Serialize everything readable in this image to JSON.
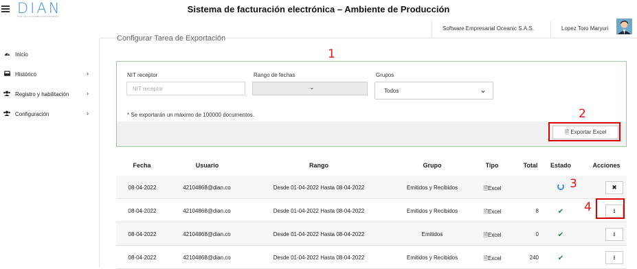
{
  "header": {
    "title": "Sistema de facturación electrónica – Ambiente de Producción",
    "logo_text": "DIAN",
    "logo_tagline": "POR UNA COLOMBIA MÁS HONESTA",
    "company": "Software Empresarial Oceanic S.A.S.",
    "user": "Lopez Toro Maryuri"
  },
  "sidebar": {
    "items": [
      {
        "label": "Inicio",
        "icon": "dashboard-icon"
      },
      {
        "label": "Histórico",
        "icon": "inbox-icon"
      },
      {
        "label": "Registro y habilitación",
        "icon": "users-icon"
      },
      {
        "label": "Configuración",
        "icon": "users-icon"
      }
    ]
  },
  "main": {
    "section_title": "Configurar Tarea de Exportación",
    "filters": {
      "nit_label": "NIT receptor",
      "nit_placeholder": "NIT receptor",
      "rango_label": "Rango de fechas",
      "grupos_label": "Grupos",
      "grupos_value": "Todos",
      "note": "* Se exportarán un máximo de 100000 documentos.",
      "export_button": "Exportar Excel"
    },
    "annotations": [
      "1",
      "2",
      "3",
      "4"
    ],
    "table": {
      "headers": [
        "Fecha",
        "Usuario",
        "Rango",
        "Grupo",
        "Tipo",
        "Total",
        "Estado",
        "Acciones"
      ],
      "rows": [
        {
          "fecha": "08-04-2022",
          "usuario": "42104868@dian.co",
          "rango": "Desde 01-04-2022 Hasta 08-04-2022",
          "grupo": "Emitidos y Recibidos",
          "tipo": "Excel",
          "total": "",
          "estado": "processing",
          "accion": "cancel"
        },
        {
          "fecha": "08-04-2022",
          "usuario": "42104868@dian.co",
          "rango": "Desde 01-04-2022 Hasta 08-04-2022",
          "grupo": "Emitidos y Recibidos",
          "tipo": "Excel",
          "total": "8",
          "estado": "done",
          "accion": "download"
        },
        {
          "fecha": "08-04-2022",
          "usuario": "42104868@dian.co",
          "rango": "Desde 01-04-2022 Hasta 08-04-2022",
          "grupo": "Emitidos",
          "tipo": "Excel",
          "total": "0",
          "estado": "done",
          "accion": "download"
        },
        {
          "fecha": "08-04-2022",
          "usuario": "42104868@dian.co",
          "rango": "Desde 01-04-2022 Hasta 08-04-2022",
          "grupo": "Emitidos y Recibidos",
          "tipo": "Excel",
          "total": "240",
          "estado": "done",
          "accion": "download"
        }
      ]
    }
  },
  "colors": {
    "accent": "#3a8fd8",
    "annotation_red": "#dd0000",
    "success": "#1a8a2a",
    "panel_border": "#9bc99e"
  }
}
